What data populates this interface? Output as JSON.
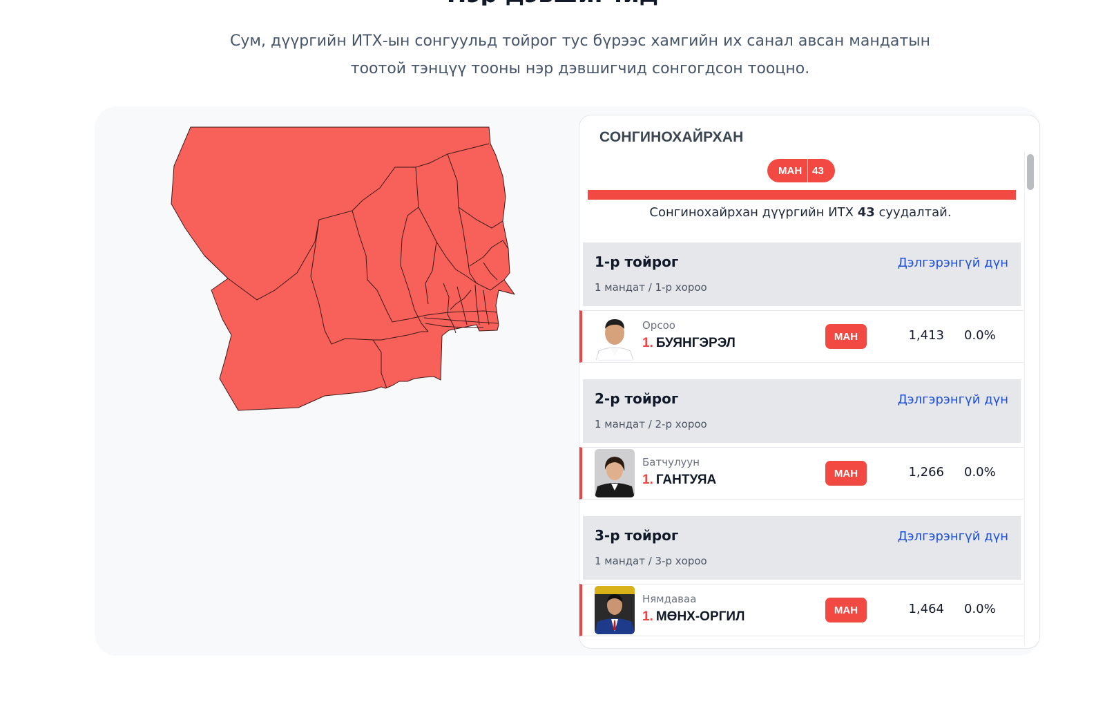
{
  "header": {
    "title_clipped": "Нэр дэвшигчид",
    "subtitle_line1": "Сум, дүүргийн ИТХ-ын сонгуульд тойрог тус бүрээс хамгийн их санал авсан мандатын",
    "subtitle_line2": "тоотой тэнцүү тооны нэр дэвшигчид сонгогдсон тооцно."
  },
  "map": {
    "fill_color": "#f8605a",
    "stroke_color": "#3d1a1a"
  },
  "card": {
    "title": "СОНГИНОХАЙРХАН",
    "party_pill": {
      "name": "МАН",
      "count": "43",
      "color": "#f24a43"
    },
    "summary_before": "Сонгинохайрхан дүүргийн ИТХ ",
    "summary_bold": "43",
    "summary_after": " суудалтай."
  },
  "districts": [
    {
      "name": "1-р тойрог",
      "sub": "1 мандат / 1-р хороо",
      "link": "Дэлгэрэнгүй дүн",
      "candidate": {
        "first_name": "Орсоо",
        "rank": "1.",
        "last_name": "БУЯНГЭРЭЛ",
        "party": "МАН",
        "votes": "1,413",
        "percent": "0.0%"
      }
    },
    {
      "name": "2-р тойрог",
      "sub": "1 мандат / 2-р хороо",
      "link": "Дэлгэрэнгүй дүн",
      "candidate": {
        "first_name": "Батчулуун",
        "rank": "1.",
        "last_name": "ГАНТУЯА",
        "party": "МАН",
        "votes": "1,266",
        "percent": "0.0%"
      }
    },
    {
      "name": "3-р тойрог",
      "sub": "1 мандат / 3-р хороо",
      "link": "Дэлгэрэнгүй дүн",
      "candidate": {
        "first_name": "Нямдаваа",
        "rank": "1.",
        "last_name": "МӨНХ-ОРГИЛ",
        "party": "МАН",
        "votes": "1,464",
        "percent": "0.0%"
      }
    }
  ]
}
